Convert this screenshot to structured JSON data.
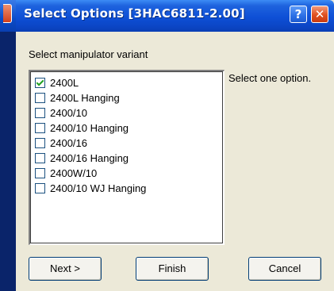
{
  "window": {
    "title": "Select Options [3HAC6811-2.00]",
    "help_button": "?",
    "close_button": "✕"
  },
  "instruction": "Select manipulator variant",
  "options": [
    {
      "label": "2400L",
      "checked": true
    },
    {
      "label": "2400L Hanging",
      "checked": false
    },
    {
      "label": "2400/10",
      "checked": false
    },
    {
      "label": "2400/10 Hanging",
      "checked": false
    },
    {
      "label": "2400/16",
      "checked": false
    },
    {
      "label": "2400/16 Hanging",
      "checked": false
    },
    {
      "label": "2400W/10",
      "checked": false
    },
    {
      "label": "2400/10 WJ Hanging",
      "checked": false
    }
  ],
  "hint": "Select one option.",
  "buttons": {
    "next": "Next >",
    "finish": "Finish",
    "cancel": "Cancel"
  },
  "colors": {
    "titlebar": "#0E4FD6",
    "dialog_bg": "#ECE9D8",
    "check_mark": "#21A121"
  }
}
